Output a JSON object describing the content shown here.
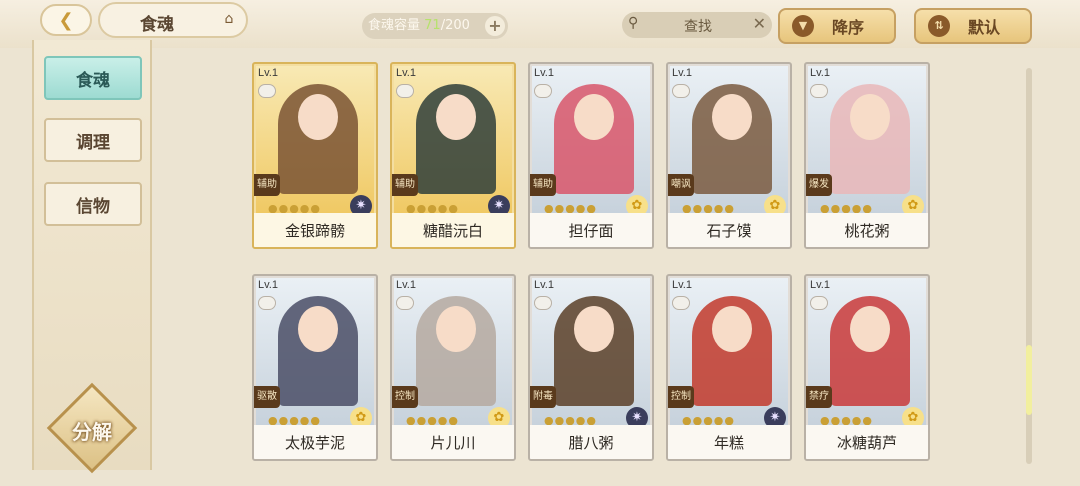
{
  "header": {
    "back_icon": "chevron-left-icon",
    "title": "食魂",
    "home_icon": "house-icon",
    "capacity_label": "食魂容量",
    "capacity_current": "71",
    "capacity_max": "/200",
    "add_label": "+",
    "search_placeholder": "查找",
    "search_clear": "✕",
    "sort_label": "降序",
    "filter_label": "默认"
  },
  "sidebar": {
    "tabs": [
      {
        "label": "食魂",
        "active": true
      },
      {
        "label": "调理",
        "active": false
      },
      {
        "label": "信物",
        "active": false
      }
    ],
    "decompose_label": "分解"
  },
  "cards": [
    {
      "lv": "Lv.1",
      "name": "金银蹄髈",
      "role": "辅助",
      "rarity": "gold",
      "element": "moon",
      "figure_color": "#7a5434"
    },
    {
      "lv": "Lv.1",
      "name": "糖醋沅白",
      "role": "辅助",
      "rarity": "gold",
      "element": "moon",
      "figure_color": "#2f3e3a"
    },
    {
      "lv": "Lv.1",
      "name": "担仔面",
      "role": "辅助",
      "rarity": "silver",
      "element": "sun",
      "figure_color": "#d8566a"
    },
    {
      "lv": "Lv.1",
      "name": "石子馍",
      "role": "嘲讽",
      "rarity": "silver",
      "element": "sun",
      "figure_color": "#7a5a40"
    },
    {
      "lv": "Lv.1",
      "name": "桃花粥",
      "role": "爆发",
      "rarity": "silver",
      "element": "sun",
      "figure_color": "#e9b7b8"
    },
    {
      "lv": "Lv.1",
      "name": "太极芋泥",
      "role": "驱散",
      "rarity": "silver",
      "element": "sun",
      "figure_color": "#4a4d66"
    },
    {
      "lv": "Lv.1",
      "name": "片儿川",
      "role": "控制",
      "rarity": "silver",
      "element": "sun",
      "figure_color": "#b5a9a0"
    },
    {
      "lv": "Lv.1",
      "name": "腊八粥",
      "role": "附毒",
      "rarity": "silver",
      "element": "moon",
      "figure_color": "#5a4028"
    },
    {
      "lv": "Lv.1",
      "name": "年糕",
      "role": "控制",
      "rarity": "silver",
      "element": "moon",
      "figure_color": "#c23a2c"
    },
    {
      "lv": "Lv.1",
      "name": "冰糖葫芦",
      "role": "禁疗",
      "rarity": "silver",
      "element": "sun",
      "figure_color": "#c93a3a"
    }
  ],
  "scroll_position": 0.85
}
